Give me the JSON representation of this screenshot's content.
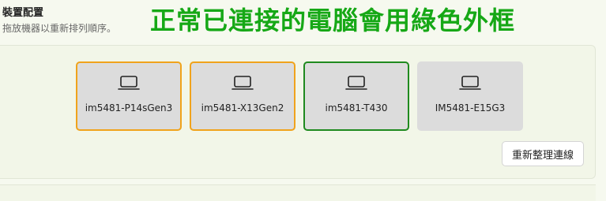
{
  "header": {
    "title": "裝置配置",
    "subtitle": "拖放機器以重新排列順序。"
  },
  "annotation": "正常已連接的電腦會用綠色外框",
  "devices": [
    {
      "label": "im5481-P14sGen3",
      "border": "#f0a31c",
      "icon": "laptop-icon"
    },
    {
      "label": "im5481-X13Gen2",
      "border": "#f0a31c",
      "icon": "laptop-icon"
    },
    {
      "label": "im5481-T430",
      "border": "#1f8a1f",
      "icon": "laptop-icon"
    },
    {
      "label": "IM5481-E15G3",
      "border": "none",
      "icon": "laptop-icon"
    }
  ],
  "actions": {
    "relink_label": "重新整理連線"
  },
  "colors": {
    "annotation": "#16a816",
    "warning_border": "#f0a31c",
    "connected_border": "#1f8a1f",
    "card_background": "#dcdcdc"
  }
}
